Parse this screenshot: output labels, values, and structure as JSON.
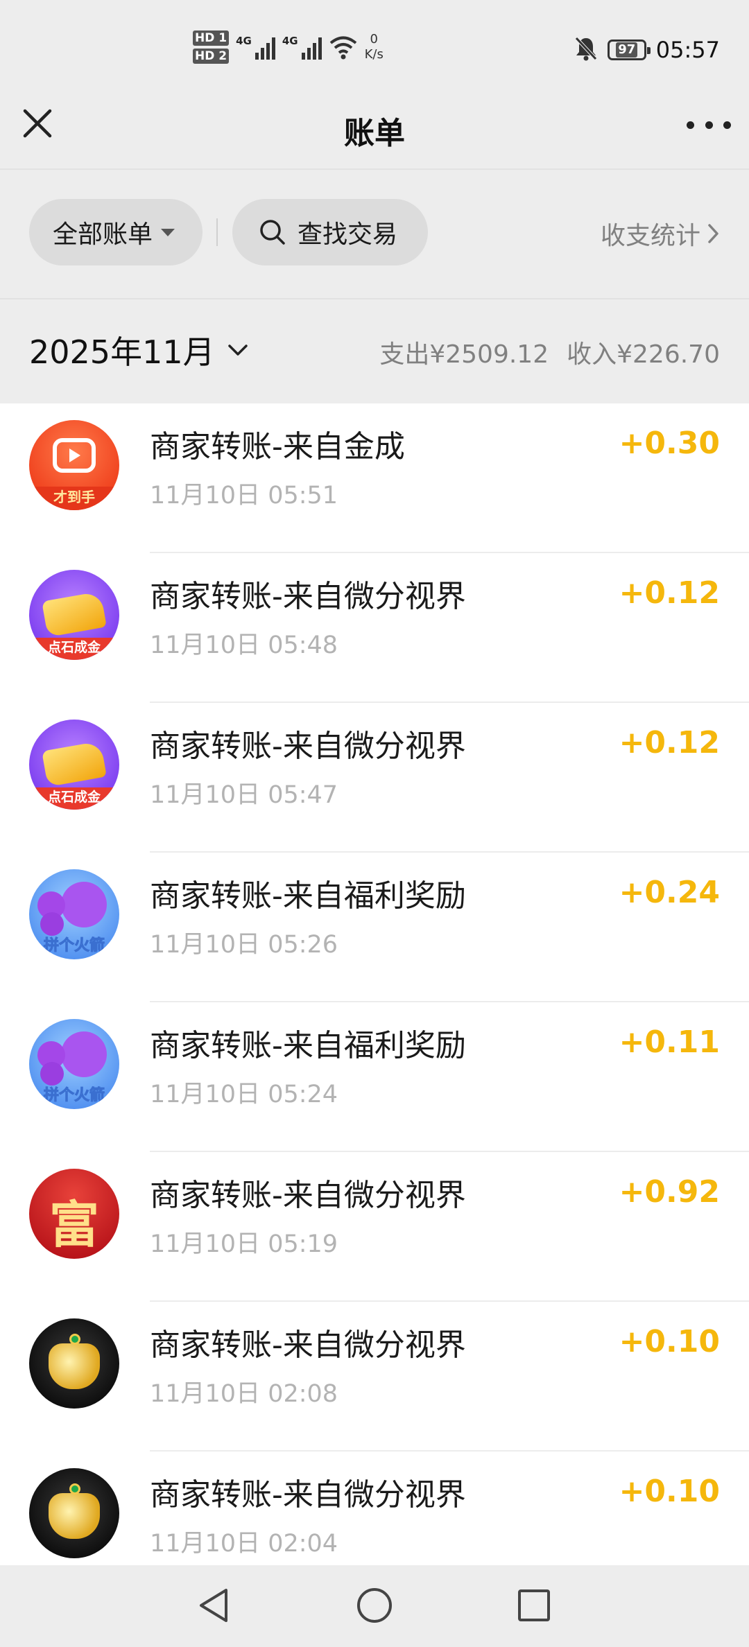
{
  "status_bar": {
    "sim1": "HD 1",
    "sim2": "HD 2",
    "net1": "4G",
    "net2": "4G",
    "speed_value": "0",
    "speed_unit": "K/s",
    "battery": "97",
    "time": "05:57"
  },
  "header": {
    "title": "账单"
  },
  "filters": {
    "all_bills": "全部账单",
    "search": "查找交易",
    "stats": "收支统计"
  },
  "month": {
    "label": "2025年11月",
    "expense": "支出¥2509.12",
    "income": "收入¥226.70"
  },
  "transactions": [
    {
      "title": "商家转账-来自金成",
      "time": "11月10日 05:51",
      "amount": "+0.30",
      "avatar_text": "才到手",
      "icon": "video-app-icon"
    },
    {
      "title": "商家转账-来自微分视界",
      "time": "11月10日 05:48",
      "amount": "+0.12",
      "avatar_text": "点石成金",
      "icon": "gold-stone-icon"
    },
    {
      "title": "商家转账-来自微分视界",
      "time": "11月10日 05:47",
      "amount": "+0.12",
      "avatar_text": "点石成金",
      "icon": "gold-stone-icon"
    },
    {
      "title": "商家转账-来自福利奖励",
      "time": "11月10日 05:26",
      "amount": "+0.24",
      "avatar_text": "拼个火箭",
      "icon": "purple-blob-icon"
    },
    {
      "title": "商家转账-来自福利奖励",
      "time": "11月10日 05:24",
      "amount": "+0.11",
      "avatar_text": "拼个火箭",
      "icon": "purple-blob-icon"
    },
    {
      "title": "商家转账-来自微分视界",
      "time": "11月10日 05:19",
      "amount": "+0.92",
      "avatar_text": "富",
      "icon": "fu-character-icon"
    },
    {
      "title": "商家转账-来自微分视界",
      "time": "11月10日 02:08",
      "amount": "+0.10",
      "avatar_text": "",
      "icon": "gold-lock-icon"
    },
    {
      "title": "商家转账-来自微分视界",
      "time": "11月10日 02:04",
      "amount": "+0.10",
      "avatar_text": "",
      "icon": "gold-lock-icon"
    }
  ],
  "colors": {
    "amount": "#f5b70c",
    "background": "#ededed",
    "secondary_text": "#808080"
  }
}
